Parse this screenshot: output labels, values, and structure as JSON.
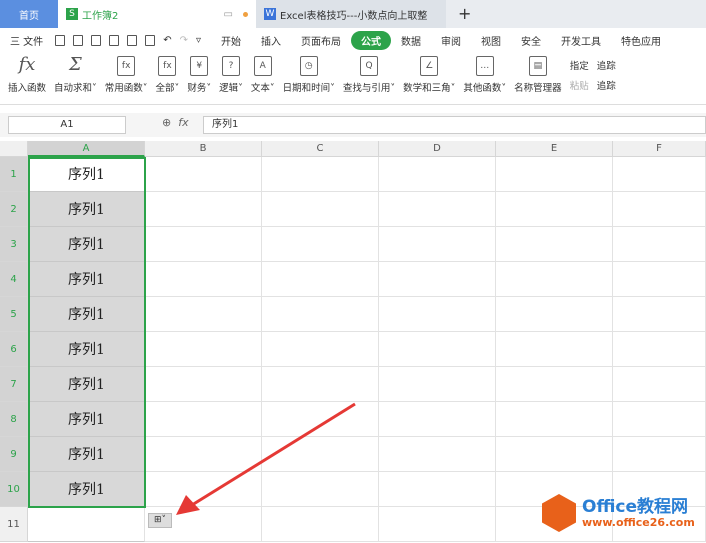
{
  "tabs": {
    "home": "首页",
    "book": "工作簿2",
    "doc": "Excel表格技巧---小数点向上取整",
    "new": "+"
  },
  "menu": {
    "file": "三 文件",
    "items": [
      "开始",
      "插入",
      "页面布局",
      "公式",
      "数据",
      "审阅",
      "视图",
      "安全",
      "开发工具",
      "特色应用"
    ],
    "active": "公式"
  },
  "ribbon": {
    "buttons": [
      {
        "icon": "fx",
        "label": "插入函数"
      },
      {
        "icon": "Σ",
        "label": "自动求和˅"
      },
      {
        "icon": "fx",
        "label": "常用函数˅"
      },
      {
        "icon": "fx",
        "label": "全部˅"
      },
      {
        "icon": "¥",
        "label": "财务˅"
      },
      {
        "icon": "?",
        "label": "逻辑˅"
      },
      {
        "icon": "A",
        "label": "文本˅"
      },
      {
        "icon": "◷",
        "label": "日期和时间˅"
      },
      {
        "icon": "Q",
        "label": "查找与引用˅"
      },
      {
        "icon": "∠",
        "label": "数学和三角˅"
      },
      {
        "icon": "…",
        "label": "其他函数˅"
      },
      {
        "icon": "▤",
        "label": "名称管理器"
      }
    ],
    "small": [
      "指定",
      "粘贴"
    ],
    "trace": [
      "追踪",
      "追踪"
    ]
  },
  "formula_bar": {
    "name_box": "A1",
    "fx": "fx",
    "value": "序列1"
  },
  "columns": [
    "A",
    "B",
    "C",
    "D",
    "E",
    "F"
  ],
  "rows": [
    "1",
    "2",
    "3",
    "4",
    "5",
    "6",
    "7",
    "8",
    "9",
    "10",
    "11"
  ],
  "column_a_values": [
    "序列1",
    "序列1",
    "序列1",
    "序列1",
    "序列1",
    "序列1",
    "序列1",
    "序列1",
    "序列1",
    "序列1"
  ],
  "fill_option": "⊞˅",
  "watermark": {
    "title": "Office教程网",
    "url": "www.office26.com"
  },
  "colors": {
    "accent": "#2ca34a",
    "tab_home": "#5b8fe0",
    "logo": "#e8611a",
    "arrow": "#e53935"
  }
}
